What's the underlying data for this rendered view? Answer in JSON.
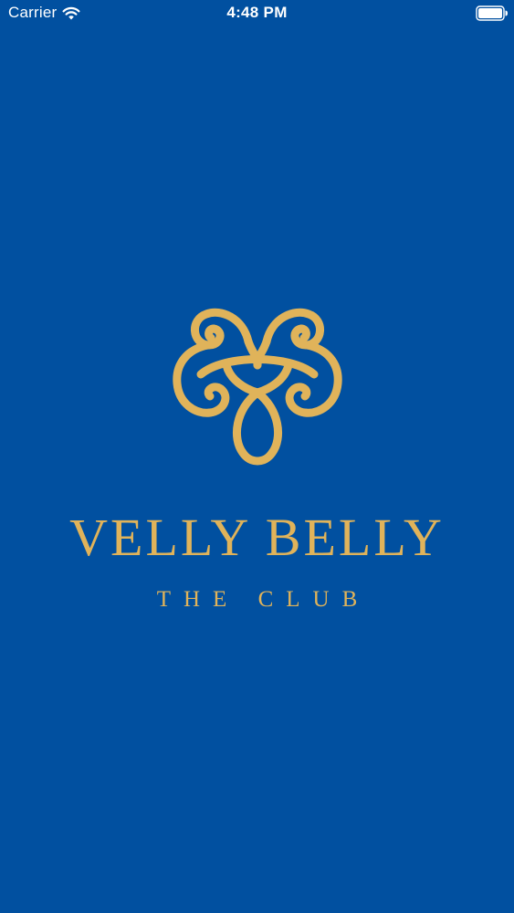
{
  "status_bar": {
    "carrier": "Carrier",
    "time": "4:48 PM",
    "icons": [
      "wifi-icon",
      "battery-icon"
    ]
  },
  "splash": {
    "brand_name": "VELLY BELLY",
    "tagline": "THE CLUB",
    "logo_icon": "ornamental-heart-logo-icon"
  },
  "colors": {
    "background": "#0150A0",
    "brand_gold": "#E0B35A",
    "status_text": "#FFFFFF"
  }
}
